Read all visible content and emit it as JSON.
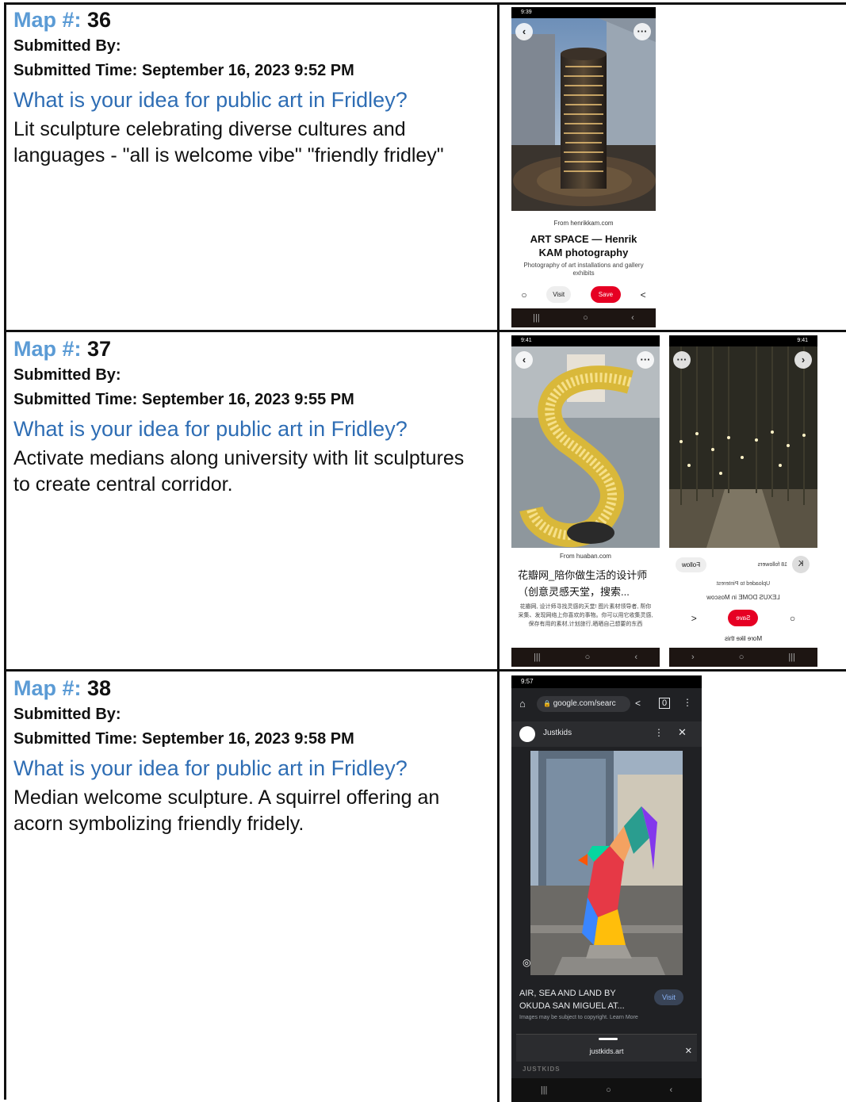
{
  "entries": [
    {
      "map_label": "Map #:",
      "map_number": "36",
      "submitted_by": "Submitted By:",
      "submitted_time": "Submitted Time: September 16, 2023 9:52 PM",
      "question": "What is your idea for public art in Fridley?",
      "answer": "Lit sculpture celebrating diverse cultures and languages - \"all is welcome vibe\" \"friendly fridley\"",
      "phones": [
        {
          "status_time": "9:39",
          "source": "From henrikkam.com",
          "title": "ART SPACE — Henrik KAM photography",
          "description": "Photography of art installations and gallery exhibits",
          "visit": "Visit",
          "save": "Save"
        }
      ]
    },
    {
      "map_label": "Map #:",
      "map_number": "37",
      "submitted_by": "Submitted By:",
      "submitted_time": "Submitted Time: September 16, 2023 9:55 PM",
      "question": "What is your idea for public art in Fridley?",
      "answer": "Activate medians along university with lit sculptures to create central corridor.",
      "phones": [
        {
          "status_time": "9:41",
          "source": "From huaban.com",
          "title": "花瓣网_陪你做生活的设计师（创意灵感天堂，搜索...",
          "description": "花瓣网, 设计师寻找灵感的天堂! 图片素材领导者, 帮你采集、发现网络上你喜欢的事物。你可以用它收集灵感,保存有用的素材,计划旅行,晒晒自己想要的东西"
        },
        {
          "status_time": "9:41",
          "follow": "Follow",
          "followers": "18 followers",
          "uploaded": "Uploaded to Pinterest",
          "location": "LEXUS DOME in Moscow",
          "save": "Save",
          "more": "More like this"
        }
      ]
    },
    {
      "map_label": "Map #:",
      "map_number": "38",
      "submitted_by": "Submitted By:",
      "submitted_time": "Submitted Time: September 16, 2023 9:58 PM",
      "question": "What is your idea for public art in Fridley?",
      "answer": "Median welcome sculpture. A squirrel offering an acorn symbolizing friendly fridely.",
      "phones": [
        {
          "status_time": "9:57",
          "url": "google.com/searc",
          "site": "Justkids",
          "caption": "AIR, SEA AND LAND BY OKUDA SAN MIGUEL AT...",
          "visit": "Visit",
          "copyright": "Images may be subject to copyright. Learn More",
          "domain": "justkids.art",
          "footer": "JUSTKIDS"
        }
      ]
    }
  ]
}
